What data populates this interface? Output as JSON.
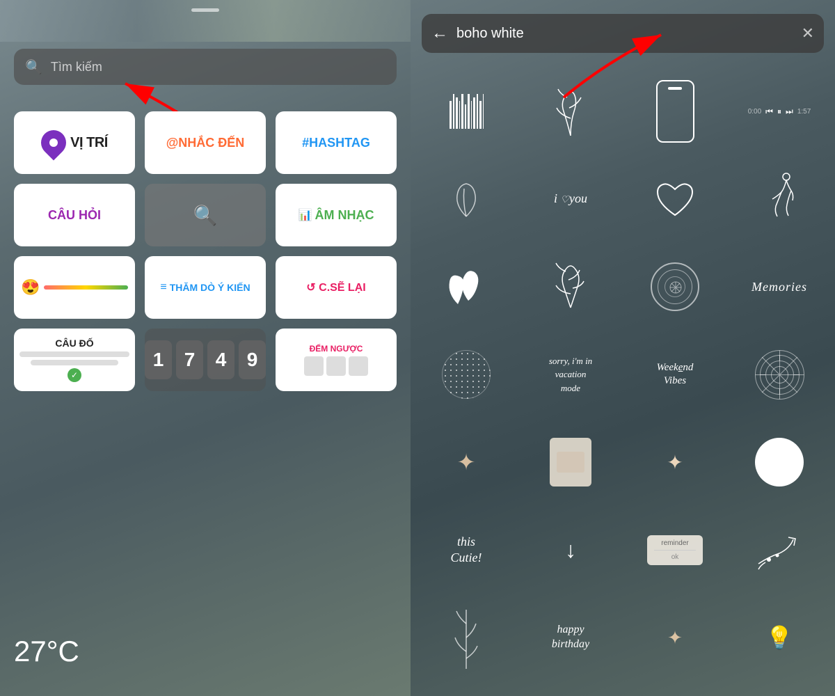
{
  "left": {
    "search_placeholder": "Tìm kiếm",
    "stickers": [
      {
        "id": "location",
        "label": "VỊ TRÍ"
      },
      {
        "id": "mention",
        "label": "@NHẮC ĐẾN"
      },
      {
        "id": "hashtag",
        "label": "#HASHTAG"
      },
      {
        "id": "cauhoi",
        "label": "CÂU HỎI"
      },
      {
        "id": "search",
        "label": ""
      },
      {
        "id": "amnhac",
        "label": "ÂM NHẠC"
      },
      {
        "id": "emoji-slider",
        "label": ""
      },
      {
        "id": "thamdo",
        "label": "THĂM DÒ Ý KIẾN"
      },
      {
        "id": "cseLai",
        "label": "↺ C.SẼ LẠI"
      },
      {
        "id": "cauDo",
        "label": "CÂU ĐỐ"
      },
      {
        "id": "countdown",
        "label": "17 49"
      },
      {
        "id": "demNguoc",
        "label": "ĐẾM NGƯỢC"
      }
    ],
    "temperature": "27°C"
  },
  "right": {
    "back_label": "←",
    "search_value": "boho white",
    "clear_label": "✕",
    "stickers": [
      {
        "id": "barcode",
        "label": "barcode"
      },
      {
        "id": "plant-branch",
        "label": "plant branch"
      },
      {
        "id": "phone-outline",
        "label": "phone outline"
      },
      {
        "id": "music-player",
        "label": "music player"
      },
      {
        "id": "leaf-sm",
        "label": "small leaf"
      },
      {
        "id": "i-love-you",
        "label": "i love you"
      },
      {
        "id": "heart-outline",
        "label": "heart outline"
      },
      {
        "id": "runner",
        "label": "runner"
      },
      {
        "id": "leaves-big",
        "label": "leaves"
      },
      {
        "id": "branch-script",
        "label": "branch script"
      },
      {
        "id": "mandala",
        "label": "mandala"
      },
      {
        "id": "memories",
        "label": "Memories"
      },
      {
        "id": "dot-circle",
        "label": "dot circle"
      },
      {
        "id": "sorry-vacation",
        "label": "sorry i'm in vacation mode"
      },
      {
        "id": "weekend-vibes",
        "label": "Weekend Vibes"
      },
      {
        "id": "mandala2",
        "label": "mandala 2"
      },
      {
        "id": "sparkle1",
        "label": "sparkle star 1"
      },
      {
        "id": "note-card",
        "label": "note card"
      },
      {
        "id": "sparkle2",
        "label": "sparkle star 2"
      },
      {
        "id": "white-circle",
        "label": "white circle"
      },
      {
        "id": "this-cutie",
        "label": "this Cutie!"
      },
      {
        "id": "down-arrow",
        "label": "down arrow"
      },
      {
        "id": "reminder",
        "label": "reminder"
      },
      {
        "id": "branch-arrow",
        "label": "branch with arrow"
      },
      {
        "id": "vertical-branches",
        "label": "vertical branches"
      },
      {
        "id": "happy-birthday",
        "label": "happy birthday"
      },
      {
        "id": "sparkle3",
        "label": "sparkle 3"
      },
      {
        "id": "light-bulb",
        "label": "light bulb"
      }
    ]
  },
  "arrows": {
    "left_arrow_label": "red arrow pointing to search",
    "right_arrow_label": "red arrow pointing to search input"
  }
}
